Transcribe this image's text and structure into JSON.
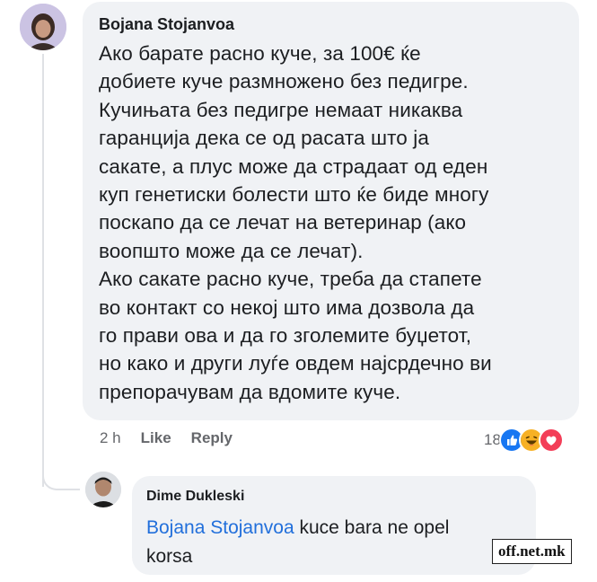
{
  "comment": {
    "author": "Bojana Stojanvoa",
    "lines": [
      "Ако барате расно куче, за 100€ ќе",
      "добиете куче размножено без педигре.",
      "Кучињата без педигре немаат никаква",
      "гаранција дека се од расата што ја",
      "сакате, а плус може да страдаат од еден",
      "куп генетиски болести што ќе биде многу",
      "поскапо да се лечат на ветеринар (ако",
      "воопшто може да се лечат).",
      "Ако сакате расно куче, треба да стапете",
      "во контакт со некој што има дозвола да",
      "го прави ова и да го зголемите буџетот,",
      "но како и други луѓе овдем најсрдечно ви",
      "препорачувам да вдомите куче."
    ],
    "time": "2 h",
    "like_label": "Like",
    "reply_label": "Reply",
    "reaction_count": "18",
    "reaction_icons": [
      "like-icon",
      "haha-icon",
      "love-icon"
    ],
    "colors": {
      "like": "#1877f2",
      "haha": "#f7b125",
      "love": "#f33e58"
    }
  },
  "reply": {
    "author": "Dime Dukleski",
    "mention": "Bojana Stojanvoa",
    "text_line1": " kuce bara ne opel",
    "text_line2": "korsa"
  },
  "watermark": "off.net.mk"
}
